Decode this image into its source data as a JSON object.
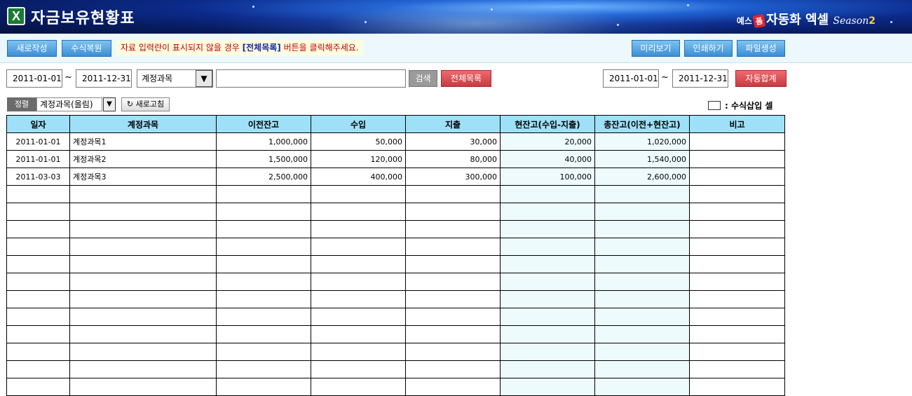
{
  "header": {
    "app_icon": "excel-x-icon",
    "title": "자금보유현황표",
    "brand_pre": "예스",
    "brand_badge": "폼",
    "brand_main": "자동화 엑셀",
    "brand_season": "Season",
    "brand_season_num": "2"
  },
  "toolbar": {
    "new_label": "새로작성",
    "restore_label": "수식복원",
    "notice_pre": "자료 입력란이 표시되지  않을 경우 ",
    "notice_bold": "[전체목록]",
    "notice_post": " 버튼을 클릭해주세요.",
    "preview_label": "미리보기",
    "print_label": "인쇄하기",
    "file_label": "파일생성"
  },
  "filter": {
    "date_from": "2011-01-01",
    "date_to": "2011-12-31",
    "tilde": "~",
    "field_select": "계정과목",
    "search_value": "",
    "search_label": "검색",
    "all_list_label": "전체목록",
    "sum_date_from": "2011-01-01",
    "sum_date_to": "2011-12-31",
    "auto_sum_label": "자동합계"
  },
  "sort": {
    "label": "정렬",
    "value": "계정과목(올림)",
    "refresh_label": "새로고침",
    "legend_text": ": 수식삽입 셀"
  },
  "colors": {
    "header_bg": "#9ee0f7",
    "calc_cell_bg": "#eefbfd",
    "button_blue": "#3b8fd6",
    "button_red": "#c83a40",
    "notice_red": "#c00000"
  },
  "table": {
    "columns": [
      "일자",
      "계정과목",
      "이전잔고",
      "수입",
      "지출",
      "현잔고(수입-지출)",
      "총잔고(이전+현잔고)",
      "비고"
    ],
    "rows": [
      [
        "2011-01-01",
        "계정과목1",
        "1,000,000",
        "50,000",
        "30,000",
        "20,000",
        "1,020,000",
        ""
      ],
      [
        "2011-01-01",
        "계정과목2",
        "1,500,000",
        "120,000",
        "80,000",
        "40,000",
        "1,540,000",
        ""
      ],
      [
        "2011-03-03",
        "계정과목3",
        "2,500,000",
        "400,000",
        "300,000",
        "100,000",
        "2,600,000",
        ""
      ]
    ],
    "empty_rows": 12
  }
}
